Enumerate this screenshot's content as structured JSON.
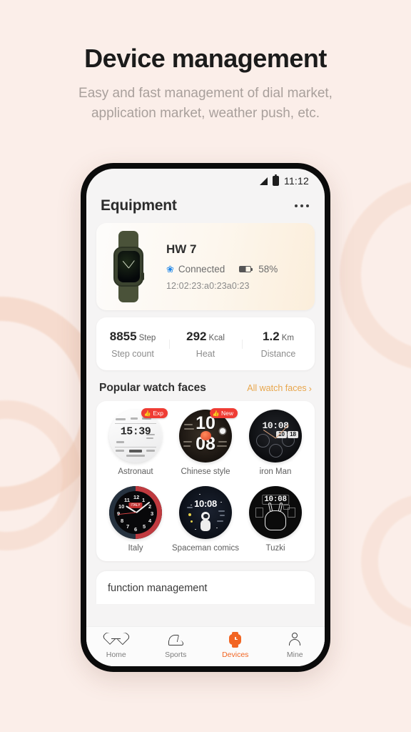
{
  "page": {
    "title": "Device management",
    "subtitle_line1": "Easy and fast management of dial market,",
    "subtitle_line2": "application market, weather push, etc."
  },
  "statusbar": {
    "time": "11:12"
  },
  "appbar": {
    "title": "Equipment",
    "menu_label": "more-options"
  },
  "device": {
    "name": "HW 7",
    "connection_status": "Connected",
    "battery_percent": "58%",
    "mac_address": "12:02:23:a0:23a0:23"
  },
  "stats": [
    {
      "value": "8855",
      "unit": "Step",
      "label": "Step count"
    },
    {
      "value": "292",
      "unit": "Kcal",
      "label": "Heat"
    },
    {
      "value": "1.2",
      "unit": "Km",
      "label": "Distance"
    }
  ],
  "watch_faces_section": {
    "title": "Popular watch faces",
    "link": "All watch faces",
    "chevron": "›"
  },
  "watch_faces": [
    {
      "name": "Astronaut",
      "badge": "Exp",
      "time": "15:39"
    },
    {
      "name": "Chinese style",
      "badge": "New",
      "hour": "10",
      "minute": "08"
    },
    {
      "name": "iron Man",
      "badge": "",
      "time": "10:08"
    },
    {
      "name": "Italy",
      "badge": "",
      "time": ""
    },
    {
      "name": "Spaceman comics",
      "badge": "",
      "time": "10:08"
    },
    {
      "name": "Tuzki",
      "badge": "",
      "time": "10:08"
    }
  ],
  "function_section": {
    "title": "function management"
  },
  "tabbar": [
    {
      "label": "Home",
      "icon": "heart-pulse-icon",
      "active": false
    },
    {
      "label": "Sports",
      "icon": "shoe-icon",
      "active": false
    },
    {
      "label": "Devices",
      "icon": "watch-icon",
      "active": true
    },
    {
      "label": "Mine",
      "icon": "person-icon",
      "active": false
    }
  ],
  "colors": {
    "background": "#fbeee9",
    "accent_orange": "#f26522",
    "link_orange": "#e8a64c",
    "badge_red": "#ef3c34"
  }
}
